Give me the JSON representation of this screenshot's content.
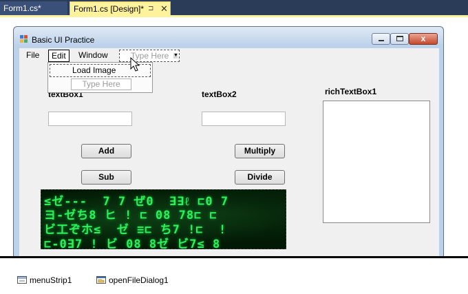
{
  "tabs": [
    {
      "label": "Form1.cs*",
      "active": false
    },
    {
      "label": "Form1.cs [Design]*",
      "active": true,
      "pin_glyph": "⊐",
      "close_glyph": "✕"
    }
  ],
  "form": {
    "title": "Basic UI Practice",
    "menu": {
      "items": [
        "File",
        "Edit",
        "Window"
      ],
      "placeholder": "Type Here",
      "dropdown": {
        "item": "Load Image",
        "placeholder": "Type Here"
      }
    },
    "labels": {
      "textbox1": "textBox1",
      "textbox2": "textBox2",
      "richtextbox": "richTextBox1"
    },
    "buttons": {
      "add": "Add",
      "multiply": "Multiply",
      "sub": "Sub",
      "divide": "Divide"
    },
    "close_glyph": "x"
  },
  "tray": {
    "components": [
      "menuStrip1",
      "openFileDialog1"
    ]
  },
  "colors": {
    "tabstrip": "#2b3c59",
    "active_tab": "#fff29d",
    "client": "#f0f0f0",
    "matrix_green": "#2df05a"
  }
}
